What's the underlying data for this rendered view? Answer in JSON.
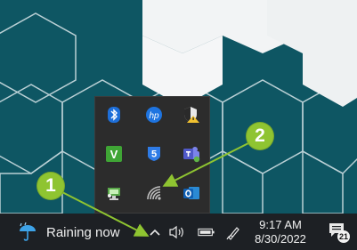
{
  "taskbar": {
    "weather": {
      "icon": "umbrella-rain-icon",
      "text": "Raining now"
    },
    "system_icons": [
      "chevron-up-icon",
      "speaker-icon",
      "battery-icon",
      "pen-icon"
    ],
    "clock": {
      "time": "9:17 AM",
      "date": "8/30/2022"
    },
    "notifications": {
      "icon": "notification-icon",
      "count": "21"
    }
  },
  "tray_popup": {
    "icons": [
      [
        "bluetooth-icon",
        "hp-icon",
        "shield-warning-icon"
      ],
      [
        "veeam-icon",
        "badge-5-icon",
        "teams-icon"
      ],
      [
        "network-pc-icon",
        "wifi-icon",
        "outlook-icon"
      ]
    ],
    "hp_text": "hp",
    "five_text": "5",
    "veeam_text": "V"
  },
  "callouts": [
    {
      "label": "1"
    },
    {
      "label": "2"
    }
  ],
  "colors": {
    "callout": "#8fc431",
    "taskbar": "#1d2024",
    "popup": "#2c2c2c",
    "desktop": "#0e5663"
  }
}
